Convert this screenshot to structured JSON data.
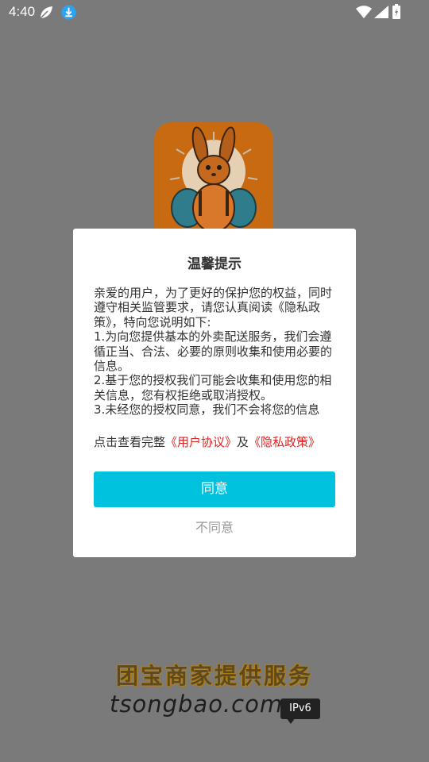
{
  "status_bar": {
    "time": "4:40"
  },
  "dialog": {
    "title": "温馨提示",
    "body_paragraphs": [
      "亲爱的用户，为了更好的保护您的权益，同时遵守相关监管要求，请您认真阅读《隐私政策》，特向您说明如下:",
      "1.为向您提供基本的外卖配送服务，我们会遵循正当、合法、必要的原则收集和使用必要的信息。",
      "2.基于您的授权我们可能会收集和使用您的相关信息，您有权拒绝或取消授权。",
      "3.未经您的授权同意，我们不会将您的信息"
    ],
    "links_prefix": "点击查看完整",
    "user_agreement_link": "《用户协议》",
    "links_conjunction": "及",
    "privacy_policy_link": "《隐私政策》",
    "agree_label": "同意",
    "disagree_label": "不同意"
  },
  "footer": {
    "slogan": "团宝商家提供服务",
    "domain": "tsongbao.com",
    "badge": "IPv6"
  },
  "colors": {
    "overlay_background": "#7a7a7a",
    "accent_button": "#00c2de",
    "link": "#e02424",
    "logo_background": "#c86a12"
  }
}
